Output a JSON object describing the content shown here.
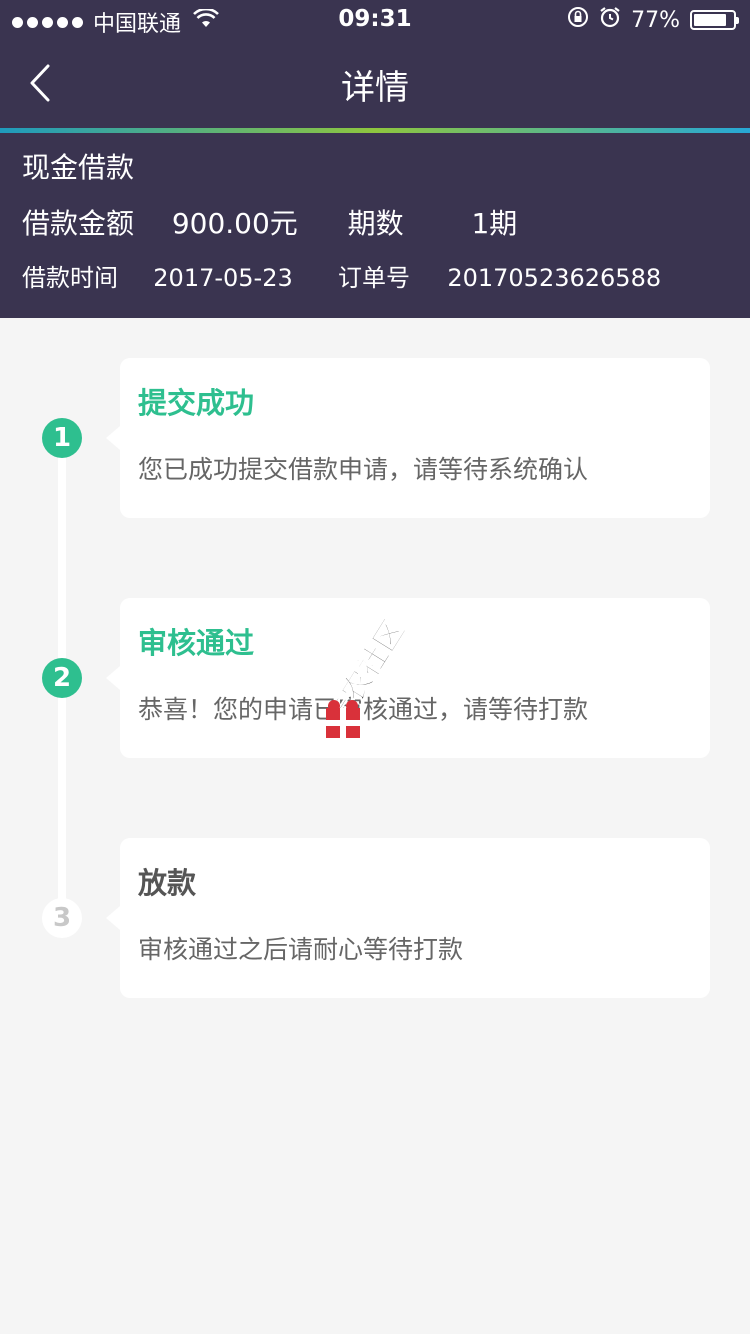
{
  "status_bar": {
    "carrier": "中国联通",
    "time": "09:31",
    "battery": "77%",
    "battery_level": 0.77
  },
  "nav": {
    "title": "详情"
  },
  "loan": {
    "type": "现金借款",
    "amount_label": "借款金额",
    "amount_value": "900.00元",
    "periods_label": "期数",
    "periods_value": "1期",
    "time_label": "借款时间",
    "time_value": "2017-05-23",
    "order_label": "订单号",
    "order_value": "20170523626588"
  },
  "steps": [
    {
      "number": "1",
      "title": "提交成功",
      "desc": "您已成功提交借款申请，请等待系统确认",
      "status": "done"
    },
    {
      "number": "2",
      "title": "审核通过",
      "desc": "恭喜！您的申请已审核通过，请等待打款",
      "status": "done"
    },
    {
      "number": "3",
      "title": "放款",
      "desc": "审核通过之后请耐心等待打款",
      "status": "pending"
    }
  ],
  "watermark": {
    "text": "卡农社区"
  },
  "colors": {
    "header_bg": "#3a3450",
    "accent_green": "#2ebf8f",
    "page_bg": "#f5f5f5"
  },
  "icons": [
    "signal-dots-icon",
    "wifi-icon",
    "rotation-lock-icon",
    "alarm-icon",
    "battery-icon",
    "back-chevron-icon"
  ]
}
